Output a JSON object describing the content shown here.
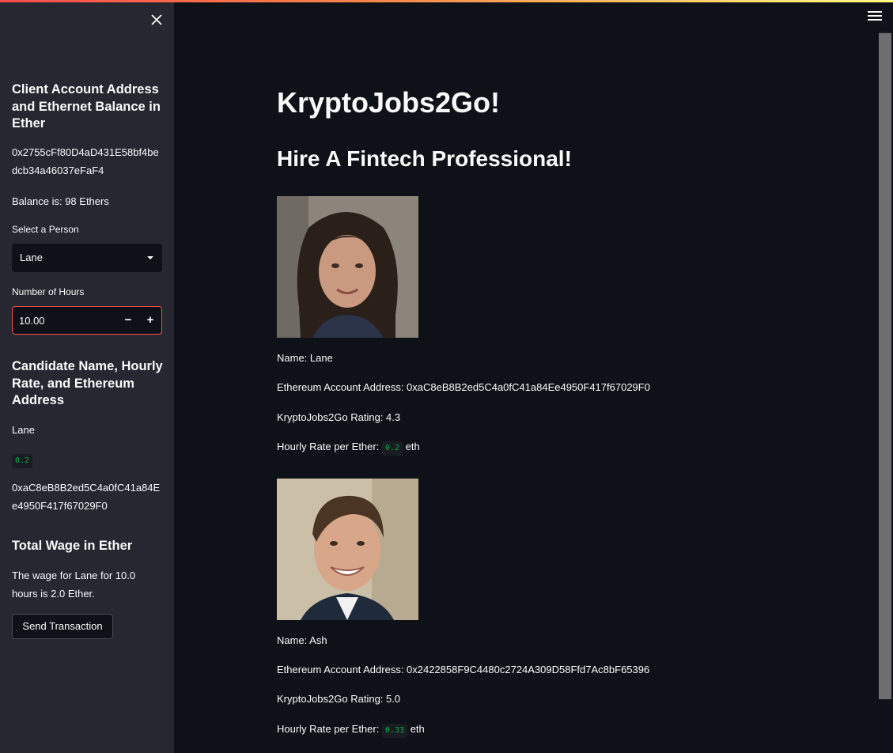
{
  "sidebar": {
    "close_icon": "close-icon",
    "account_header": "Client Account Address and Ethernet Balance in Ether",
    "account_address": "0x2755cFf80D4aD431E58bf4bedcb34a46037eFaF4",
    "balance_text": "Balance is: 98 Ethers",
    "select_label": "Select a Person",
    "selected_person": "Lane",
    "hours_label": "Number of Hours",
    "hours_value": "10.00",
    "minus_label": "−",
    "plus_label": "+",
    "candidate_header": "Candidate Name, Hourly Rate, and Ethereum Address",
    "candidate_name": "Lane",
    "candidate_rate": "0.2",
    "candidate_address": "0xaC8eB8B2ed5C4a0fC41a84Ee4950F417f67029F0",
    "wage_header": "Total Wage in Ether",
    "wage_text": "The wage for Lane for 10.0 hours is 2.0 Ether.",
    "send_button": "Send Transaction"
  },
  "main": {
    "title": "KryptoJobs2Go!",
    "subtitle": "Hire A Fintech Professional!",
    "candidates": [
      {
        "name": "Name: Lane",
        "address": "Ethereum Account Address: 0xaC8eB8B2ed5C4a0fC41a84Ee4950F417f67029F0",
        "rating": "KryptoJobs2Go Rating: 4.3",
        "rate_prefix": "Hourly Rate per Ether:",
        "rate_value": "0.2",
        "rate_suffix": "eth"
      },
      {
        "name": "Name: Ash",
        "address": "Ethereum Account Address: 0x2422858F9C4480c2724A309D58Ffd7Ac8bF65396",
        "rating": "KryptoJobs2Go Rating: 5.0",
        "rate_prefix": "Hourly Rate per Ether:",
        "rate_value": "0.33",
        "rate_suffix": "eth"
      }
    ]
  },
  "icons": {
    "menu": "hamburger-menu-icon",
    "dropdown": "chevron-down-icon"
  },
  "colors": {
    "background": "#0e1117",
    "sidebar": "#262730",
    "accent": "#ff4b4b",
    "code_green": "#09ab3b"
  }
}
